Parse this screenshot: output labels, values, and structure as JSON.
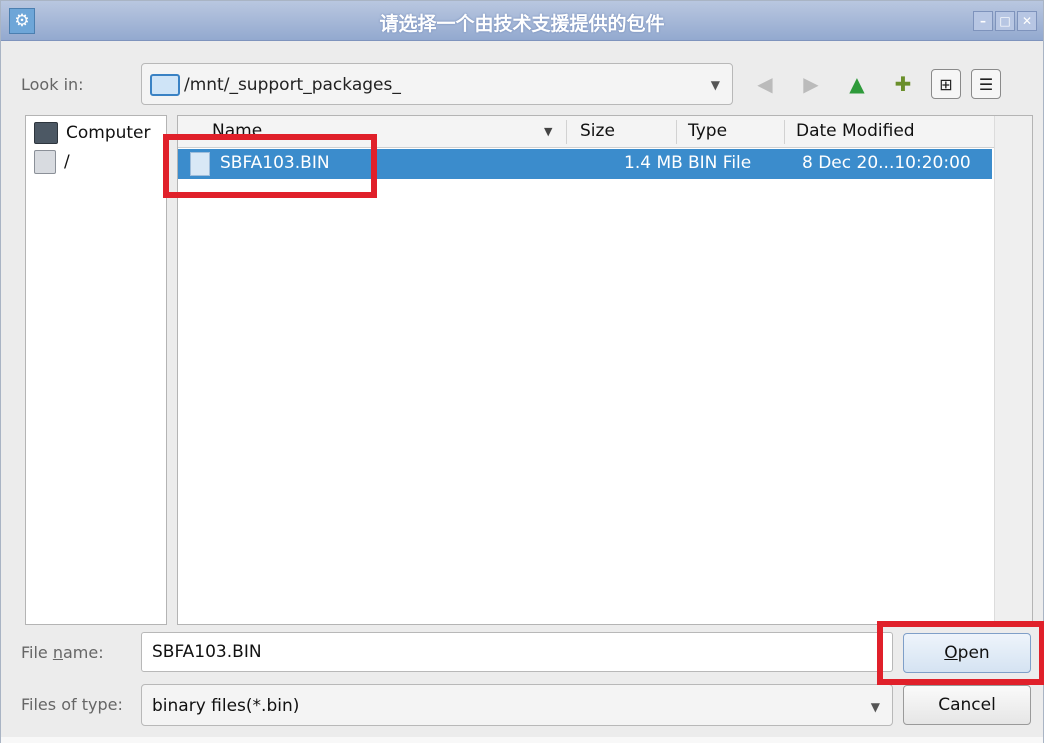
{
  "window": {
    "title": "请选择一个由技术支援提供的包件",
    "app_icon": "settings-gear-icon"
  },
  "lookin": {
    "label": "Look in:",
    "path": "/mnt/_support_packages_"
  },
  "toolbar": {
    "back_icon": "back-arrow-icon",
    "forward_icon": "forward-arrow-icon",
    "up_icon": "up-arrow-icon",
    "new_folder_icon": "new-folder-icon",
    "detail_view_icon": "grid-view-icon",
    "list_view_icon": "list-view-icon"
  },
  "sidebar": {
    "items": [
      {
        "label": "Computer"
      },
      {
        "label": "/"
      }
    ]
  },
  "columns": {
    "name": "Name",
    "size": "Size",
    "type": "Type",
    "date": "Date Modified"
  },
  "files": [
    {
      "name": "SBFA103.BIN",
      "size": "1.4 MB",
      "type": "BIN File",
      "date": "8 Dec 20...10:20:00"
    }
  ],
  "footer": {
    "filename_label_pre": "File ",
    "filename_label_underlined": "n",
    "filename_label_post": "ame:",
    "filename_value": "SBFA103.BIN",
    "filetype_label": "Files of type:",
    "filetype_value": "binary files(*.bin)",
    "open_underlined": "O",
    "open_rest": "pen",
    "cancel_label": "Cancel"
  },
  "colors": {
    "selection": "#3b8ccc",
    "annotation": "#e0202a"
  }
}
